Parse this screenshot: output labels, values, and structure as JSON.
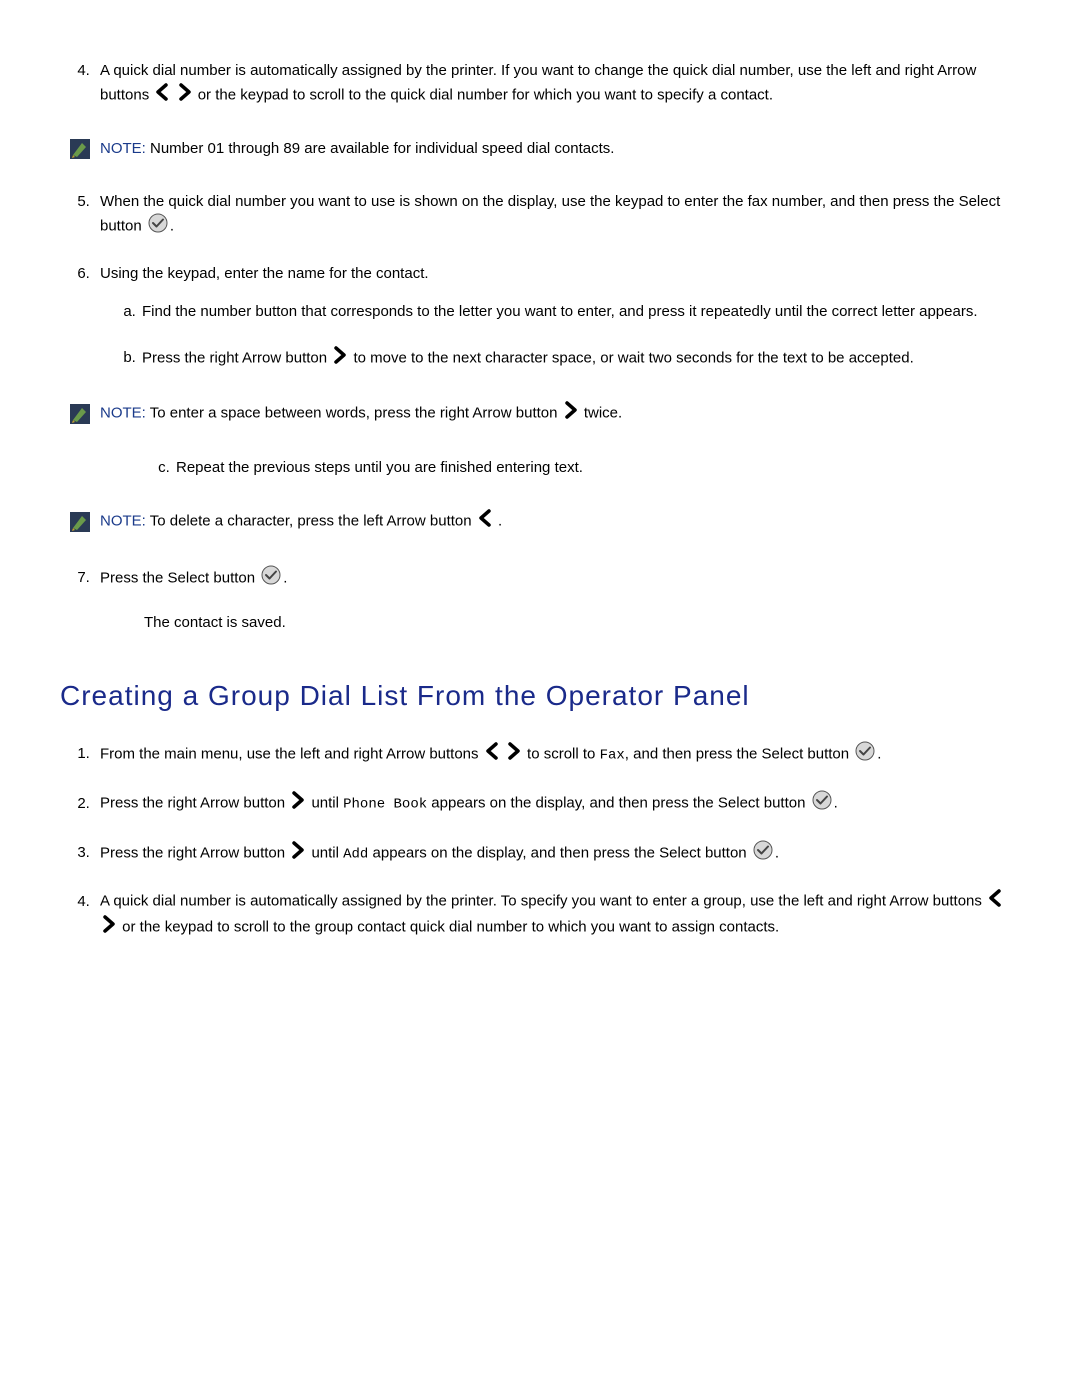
{
  "list1": {
    "item4_a": "A quick dial number is automatically assigned by the printer. If you want to change the quick dial number, use the left and right Arrow buttons ",
    "item4_b": " or the keypad to scroll to the quick dial number for which you want to specify a contact.",
    "item5_a": "When the quick dial number you want to use is shown on the display, use the keypad to enter the fax number, and then press the Select button ",
    "item5_b": ".",
    "item6": "Using the keypad, enter the name for the contact.",
    "item6a": "Find the number button that corresponds to the letter you want to enter, and press it repeatedly until the correct letter appears.",
    "item6b_a": "Press the right Arrow button ",
    "item6b_b": " to move to the next character space, or wait two seconds for the text to be accepted.",
    "item6c": "Repeat the previous steps until you are finished entering text.",
    "item7_a": "Press the Select button ",
    "item7_b": ".",
    "item7_saved": "The contact is saved."
  },
  "notes": {
    "label": "NOTE:",
    "note1": " Number 01 through 89 are available for individual speed dial contacts.",
    "note2_a": " To enter a space between words, press the right Arrow button ",
    "note2_b": " twice.",
    "note3_a": " To delete a character, press the left Arrow button ",
    "note3_b": " ."
  },
  "heading": "Creating a Group Dial List From the Operator Panel",
  "list2": {
    "item1_a": "From the main menu, use the left and right Arrow buttons ",
    "item1_b": " to scroll to ",
    "item1_fax": "Fax",
    "item1_c": ", and then press the Select button ",
    "item1_d": ".",
    "item2_a": "Press the right Arrow button ",
    "item2_b": " until ",
    "item2_pb": "Phone Book",
    "item2_c": " appears on the display, and then press the Select button ",
    "item2_d": ".",
    "item3_a": "Press the right Arrow button ",
    "item3_b": " until ",
    "item3_add": "Add",
    "item3_c": " appears on the display, and then press the Select button ",
    "item3_d": ".",
    "item4_a": "A quick dial number is automatically assigned by the printer. To specify you want to enter a group, use the left and right Arrow buttons ",
    "item4_b": " or the keypad to scroll to the group contact quick dial number to which you want to assign contacts."
  }
}
